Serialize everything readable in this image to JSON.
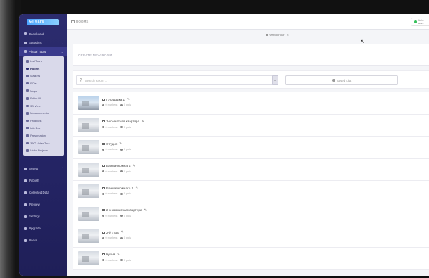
{
  "sidebar": {
    "logo_text": "GTMars",
    "items_top": [
      {
        "label": "Dashboard",
        "icon": "dashboard-icon"
      },
      {
        "label": "Statistics",
        "icon": "chart-icon"
      },
      {
        "label": "Virtual Tours",
        "icon": "tour-icon"
      }
    ],
    "submenu": [
      {
        "label": "List Tours",
        "icon": "list-icon"
      },
      {
        "label": "Rooms",
        "icon": "rooms-icon"
      },
      {
        "label": "Markers",
        "icon": "marker-icon"
      },
      {
        "label": "POIs",
        "icon": "poi-icon"
      },
      {
        "label": "Maps",
        "icon": "map-icon"
      },
      {
        "label": "Editor UI",
        "icon": "editor-icon"
      },
      {
        "label": "3D View",
        "icon": "cube-icon"
      },
      {
        "label": "Measurements",
        "icon": "ruler-icon"
      },
      {
        "label": "Products",
        "icon": "product-icon"
      },
      {
        "label": "Info Box",
        "icon": "info-icon"
      },
      {
        "label": "Presentation",
        "icon": "presentation-icon"
      },
      {
        "label": "360° Video Tour",
        "icon": "video-icon"
      },
      {
        "label": "Video Projects",
        "icon": "film-icon"
      }
    ],
    "items_bottom": [
      {
        "label": "Assets",
        "icon": "folder-icon"
      },
      {
        "label": "Publish",
        "icon": "share-icon"
      },
      {
        "label": "Collected Data",
        "icon": "database-icon"
      },
      {
        "label": "Preview",
        "icon": "eye-icon"
      },
      {
        "label": "Settings",
        "icon": "gear-icon"
      },
      {
        "label": "Upgrade",
        "icon": "upgrade-icon"
      },
      {
        "label": "Users",
        "icon": "users-icon"
      }
    ]
  },
  "topbar": {
    "breadcrumb": "ROOMS",
    "status_text": "Auto save"
  },
  "main": {
    "tour_name": "webtourtour",
    "create_label": "CREATE NEW ROOM",
    "search_placeholder": "Search Room ...",
    "save_list_label": "Saved List",
    "rooms": [
      {
        "title": "Площадка 1"
      },
      {
        "title": "1-комнатная квартира"
      },
      {
        "title": "Студия"
      },
      {
        "title": "Ванная комната"
      },
      {
        "title": "Ванная комната 2"
      },
      {
        "title": "2-х комнатная квартира"
      },
      {
        "title": "2-й этаж"
      },
      {
        "title": "Кухня"
      }
    ],
    "row_meta_a": "0 markers",
    "row_meta_b": "0 pois"
  },
  "colors": {
    "sidebar_bg": "#2a2a6a",
    "accent": "#31c4c4",
    "online": "#35c05a"
  }
}
